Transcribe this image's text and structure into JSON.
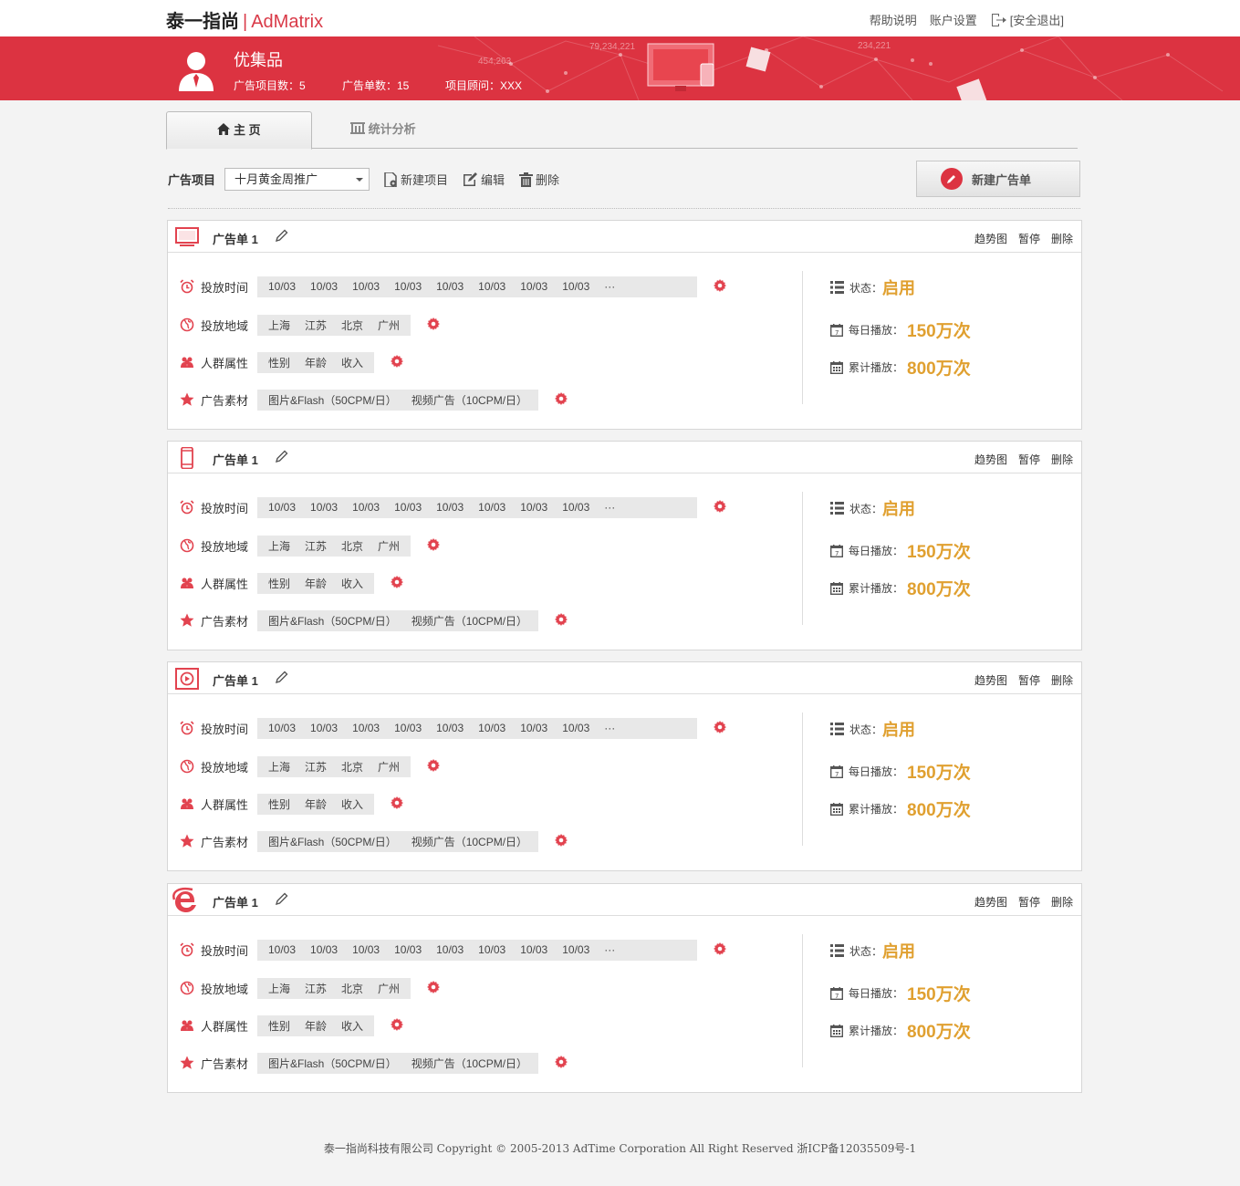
{
  "header": {
    "logo_cn": "泰一指尚",
    "logo_sep": "|",
    "logo_brand": "AdMatrix",
    "links": {
      "help": "帮助说明",
      "account": "账户设置",
      "logout": "[安全退出]"
    }
  },
  "banner": {
    "user_name": "优集品",
    "project_count": "广告项目数：5",
    "order_count": "广告单数：15",
    "consultant": "项目顾问：XXX",
    "deco_numbers": [
      "79,234,221",
      "454,263",
      "234,221"
    ]
  },
  "tabs": {
    "home": "主  页",
    "stats": "统计分析"
  },
  "toolbar": {
    "project_label": "广告项目",
    "project_selected": "十月黄金周推广",
    "new_project": "新建项目",
    "edit": "编辑",
    "delete": "删除",
    "new_ad": "新建广告单"
  },
  "cards": [
    {
      "type_icon": "tv-icon",
      "title": "广告单 1",
      "actions": {
        "trend": "趋势图",
        "pause": "暂停",
        "delete": "删除"
      },
      "labels": {
        "time": "投放时间",
        "region": "投放地域",
        "crowd": "人群属性",
        "material": "广告素材"
      },
      "times": [
        "10/03",
        "10/03",
        "10/03",
        "10/03",
        "10/03",
        "10/03",
        "10/03",
        "10/03",
        "···"
      ],
      "regions": [
        "上海",
        "江苏",
        "北京",
        "广州"
      ],
      "crowd": [
        "性别",
        "年龄",
        "收入"
      ],
      "materials": [
        "图片&Flash（50CPM/日）",
        "视频广告（10CPM/日）"
      ],
      "status_label": "状态：",
      "status_value": "启用",
      "daily_label": "每日播放：",
      "daily_value": "150万次",
      "total_label": "累计播放：",
      "total_value": "800万次"
    },
    {
      "type_icon": "mobile-icon",
      "title": "广告单 1",
      "actions": {
        "trend": "趋势图",
        "pause": "暂停",
        "delete": "删除"
      },
      "labels": {
        "time": "投放时间",
        "region": "投放地域",
        "crowd": "人群属性",
        "material": "广告素材"
      },
      "times": [
        "10/03",
        "10/03",
        "10/03",
        "10/03",
        "10/03",
        "10/03",
        "10/03",
        "10/03",
        "···"
      ],
      "regions": [
        "上海",
        "江苏",
        "北京",
        "广州"
      ],
      "crowd": [
        "性别",
        "年龄",
        "收入"
      ],
      "materials": [
        "图片&Flash（50CPM/日）",
        "视频广告（10CPM/日）"
      ],
      "status_label": "状态：",
      "status_value": "启用",
      "daily_label": "每日播放：",
      "daily_value": "150万次",
      "total_label": "累计播放：",
      "total_value": "800万次"
    },
    {
      "type_icon": "video-icon",
      "title": "广告单 1",
      "actions": {
        "trend": "趋势图",
        "pause": "暂停",
        "delete": "删除"
      },
      "labels": {
        "time": "投放时间",
        "region": "投放地域",
        "crowd": "人群属性",
        "material": "广告素材"
      },
      "times": [
        "10/03",
        "10/03",
        "10/03",
        "10/03",
        "10/03",
        "10/03",
        "10/03",
        "10/03",
        "···"
      ],
      "regions": [
        "上海",
        "江苏",
        "北京",
        "广州"
      ],
      "crowd": [
        "性别",
        "年龄",
        "收入"
      ],
      "materials": [
        "图片&Flash（50CPM/日）",
        "视频广告（10CPM/日）"
      ],
      "status_label": "状态：",
      "status_value": "启用",
      "daily_label": "每日播放：",
      "daily_value": "150万次",
      "total_label": "累计播放：",
      "total_value": "800万次"
    },
    {
      "type_icon": "ie-browser-icon",
      "title": "广告单 1",
      "actions": {
        "trend": "趋势图",
        "pause": "暂停",
        "delete": "删除"
      },
      "labels": {
        "time": "投放时间",
        "region": "投放地域",
        "crowd": "人群属性",
        "material": "广告素材"
      },
      "times": [
        "10/03",
        "10/03",
        "10/03",
        "10/03",
        "10/03",
        "10/03",
        "10/03",
        "10/03",
        "···"
      ],
      "regions": [
        "上海",
        "江苏",
        "北京",
        "广州"
      ],
      "crowd": [
        "性别",
        "年龄",
        "收入"
      ],
      "materials": [
        "图片&Flash（50CPM/日）",
        "视频广告（10CPM/日）"
      ],
      "status_label": "状态：",
      "status_value": "启用",
      "daily_label": "每日播放：",
      "daily_value": "150万次",
      "total_label": "累计播放：",
      "total_value": "800万次"
    }
  ],
  "footer": "泰一指尚科技有限公司 Copyright © 2005-2013 AdTime Corporation All Right Reserved 浙ICP备12035509号-1",
  "colors": {
    "brand_red": "#dc3341",
    "value_gold": "#e0a030"
  }
}
